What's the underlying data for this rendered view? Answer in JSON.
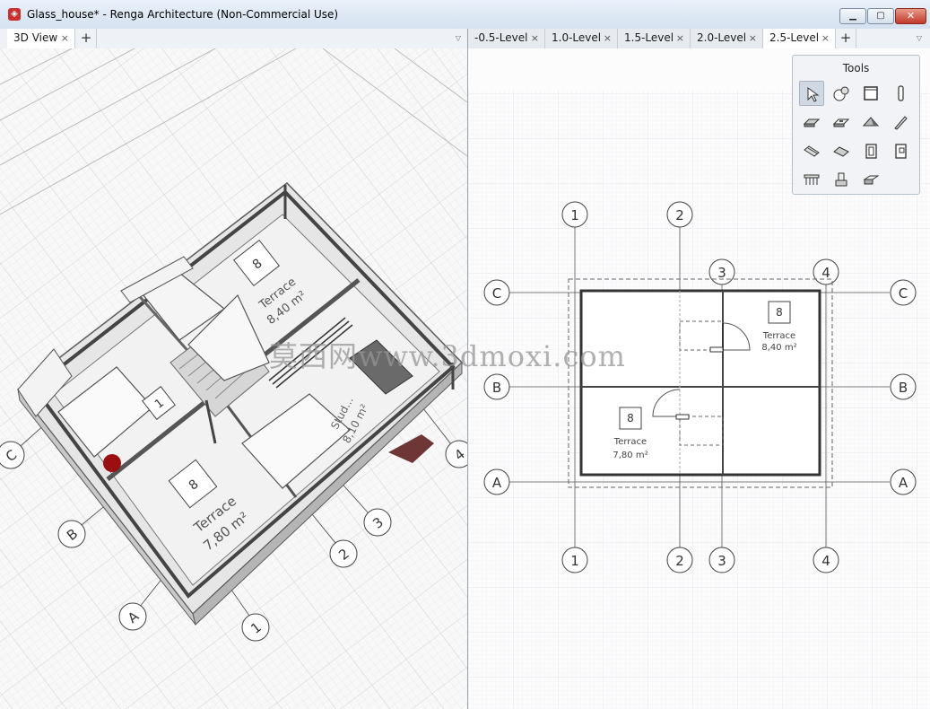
{
  "window": {
    "title": "Glass_house* - Renga Architecture (Non-Commercial Use)",
    "app_icon": "renga-logo-icon",
    "minimize_glyph": "▁",
    "maximize_glyph": "▢",
    "close_glyph": "✕"
  },
  "left_tabs": [
    {
      "label": "3D View",
      "close": "×",
      "active": true
    }
  ],
  "right_tabs": [
    {
      "label": "-0.5-Level",
      "close": "×",
      "active": false
    },
    {
      "label": "1.0-Level",
      "close": "×",
      "active": false
    },
    {
      "label": "1.5-Level",
      "close": "×",
      "active": false
    },
    {
      "label": "2.0-Level",
      "close": "×",
      "active": false
    },
    {
      "label": "2.5-Level",
      "close": "×",
      "active": true
    }
  ],
  "tab_add": "+",
  "tab_menu": "▽",
  "tools_panel": {
    "title": "Tools",
    "items": [
      "select-icon",
      "dimension-icon",
      "window-icon",
      "column-icon",
      "slab-icon",
      "floor-icon",
      "roof-icon",
      "beam-icon",
      "stair-icon",
      "ramp-icon",
      "door-icon",
      "opening-icon",
      "railing-icon",
      "equipment-icon",
      "element-icon"
    ]
  },
  "view3d": {
    "room_top": {
      "number": "8",
      "name": "Terrace",
      "area": "8,40 m²"
    },
    "room_bottom": {
      "number": "8",
      "name": "Terrace",
      "area": "7,80 m²"
    },
    "room_small": {
      "number": "1"
    },
    "room_studio": {
      "name": "Stud...",
      "area": "8,10 m²"
    },
    "axes": {
      "a1": "1",
      "a2": "2",
      "a3": "3",
      "a4": "4",
      "aA": "A",
      "aB": "B",
      "aC": "C"
    }
  },
  "plan": {
    "axes_top": [
      "1",
      "2",
      "3",
      "4"
    ],
    "axes_bottom": [
      "1",
      "2",
      "3",
      "4"
    ],
    "axes_left": [
      "C",
      "B",
      "A"
    ],
    "axes_right": [
      "C",
      "B",
      "A"
    ],
    "room1": {
      "number": "8",
      "name": "Terrace",
      "area": "8,40 m²"
    },
    "room2": {
      "number": "8",
      "name": "Terrace",
      "area": "7,80 m²"
    }
  },
  "watermark": "莫西网www.3dmoxi.com"
}
